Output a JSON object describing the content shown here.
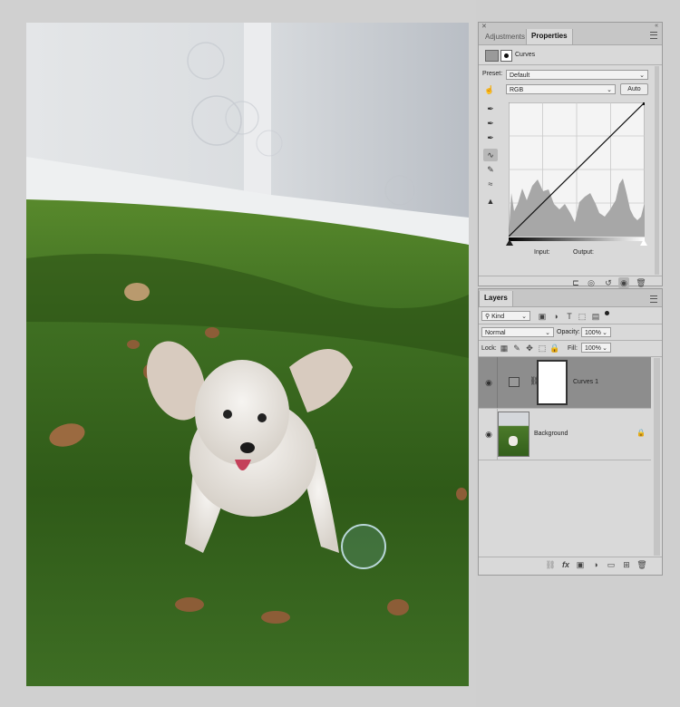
{
  "properties_panel": {
    "tabs": [
      "Adjustments",
      "Properties"
    ],
    "title": "Curves",
    "preset_label": "Preset:",
    "preset_value": "Default",
    "channel_value": "RGB",
    "auto_label": "Auto",
    "input_label": "Input:",
    "output_label": "Output:"
  },
  "layers_panel": {
    "tab": "Layers",
    "filter_kind": "Kind",
    "blend_mode": "Normal",
    "opacity_label": "Opacity:",
    "opacity_value": "100%",
    "lock_label": "Lock:",
    "fill_label": "Fill:",
    "fill_value": "100%",
    "layers": [
      {
        "name": "Curves 1",
        "selected": true
      },
      {
        "name": "Background",
        "selected": false
      }
    ]
  },
  "icons": [
    "close-icon",
    "collapse-icon",
    "panel-menu-icon",
    "curves-adjustment-icon",
    "mask-icon",
    "eye-icon",
    "lock-icon",
    "trash-icon",
    "fx-icon",
    "new-layer-icon",
    "folder-icon"
  ],
  "colors": {
    "panel_bg": "#d9d9d9",
    "tab_bg": "#c6c6c6",
    "selected_layer": "#8d8d8d",
    "grass": "#3b6a1f",
    "fence": "#cfd3d8"
  }
}
